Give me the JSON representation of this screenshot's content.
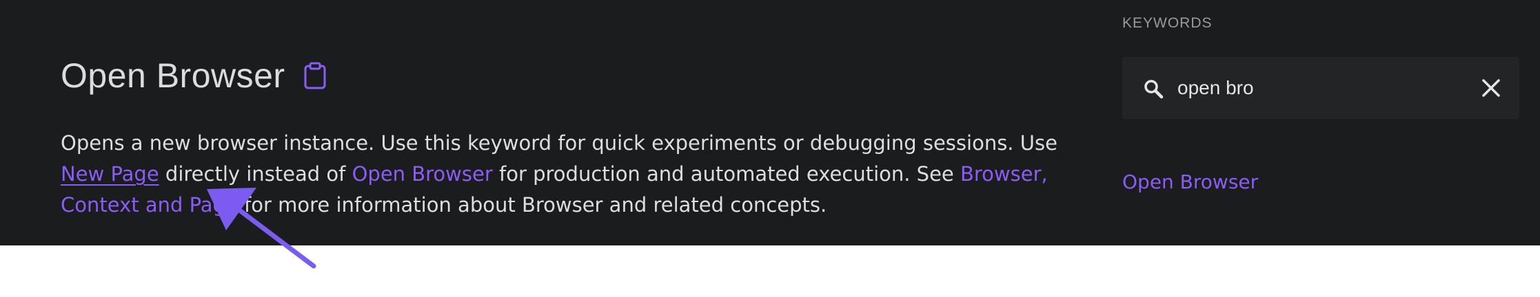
{
  "main": {
    "title": "Open Browser",
    "description": {
      "part1": "Opens a new browser instance. Use this keyword for quick experiments or debugging sessions. Use ",
      "link_new_page": "New Page",
      "part2": " directly instead of ",
      "link_open_browser": "Open Browser",
      "part3": " for production and automated execution. See ",
      "link_bcp": "Browser, Context and Page",
      "part4": " for more information about Browser and related concepts."
    }
  },
  "sidebar": {
    "heading": "KEYWORDS",
    "search": {
      "value": "open bro"
    },
    "results": [
      "Open Browser"
    ]
  },
  "colors": {
    "accent": "#8b5cf6",
    "background": "#1b1c1e",
    "text": "#dedede"
  },
  "icons": {
    "copy": "clipboard-icon",
    "search": "search-icon",
    "clear": "close-icon",
    "annotation": "arrow-icon"
  }
}
